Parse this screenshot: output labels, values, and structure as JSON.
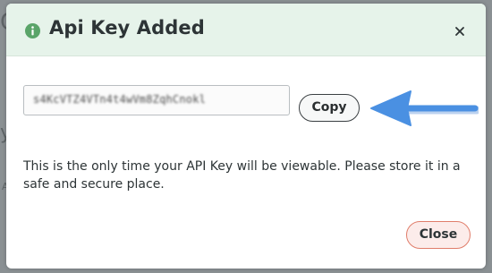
{
  "dialog": {
    "title": "Api Key Added",
    "title_icon": "info-icon",
    "close_icon": "close-icon",
    "api_key_value": "s4KcVTZ4VTn4t4wVm8ZqhCnokl",
    "copy_label": "Copy",
    "message": "This is the only time your API Key will be viewable. Please store it in a safe and secure place.",
    "close_label": "Close"
  },
  "annotation": {
    "arrow_icon": "arrow-left-icon",
    "arrow_color": "#4a90e2"
  },
  "colors": {
    "header_bg": "#e6f3ea",
    "info_green": "#5aa469",
    "close_button_border": "#e07d6a",
    "close_button_bg": "#fcecea"
  }
}
